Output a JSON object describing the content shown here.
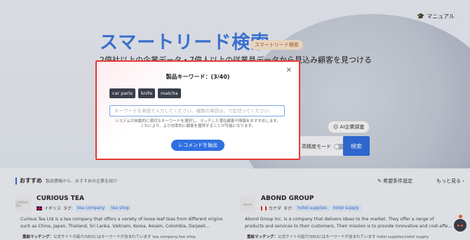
{
  "header": {
    "manual_label": "マニュアル"
  },
  "hero": {
    "title": "スマートリード検索",
    "badge": "スマートリード検索",
    "subtitle": "2億社以上の企業データ・7億人以上の従業員データから見込み顧客を見つける",
    "ai_button": "AI企業調査",
    "high_precision_label": "高精度モード",
    "search_button": "検索"
  },
  "modal": {
    "title": "製品キーワード：(3/40)",
    "keywords": [
      "car parts",
      "knife",
      "matcha"
    ],
    "input_placeholder": "キーワードを英語で入力してください。複数の単語は、で区切ってください。",
    "note_line1": "システムが自動的に適切なキーワードを選択し、マッチした潜在顧客や情報をおすすめします。",
    "note_line2": "これにより、より効率的に顧客を獲得することが可能になります。",
    "extract_button": "レコメンドを抽出"
  },
  "recommend": {
    "title": "おすすめ",
    "description": "製品情報から、おすすめの企業を紹介",
    "preference_link": "希望条件設定",
    "more_link": "もっと見る"
  },
  "companies": [
    {
      "name": "CURIOUS TEA",
      "logo_text": "CURIOUS TEA",
      "country": "イギリス",
      "tags_label": "タグ:",
      "tags": [
        "tea company",
        "tea shop"
      ],
      "description": "Curious Tea Ltd is a tea company that offers a variety of loose leaf teas from different origins such as China, Japan, Thailand, Sri Lanka, Vietnam, Korea, Assam, Colombia, Darjeeli...",
      "match_label": "重絵マッチング：",
      "match_text": "公式サイトの紹介/SEOにはキーワードが含まれています tea company,tea shop"
    },
    {
      "name": "ABOND GROUP",
      "logo_text": "abond",
      "country": "カナダ",
      "tags_label": "タグ:",
      "tags": [
        "hotel supplies",
        "hotel supply"
      ],
      "description": "Abond Group Inc. is a company that delivers ideas to the market. They offer a range of products and services to their customers. Their mission is to provide innovative and cost-effe...",
      "match_label": "重絵マッチング：",
      "match_text": "公式サイトの紹介/SEOにはキーワードが含まれています hotel supplies,hotel supply"
    }
  ],
  "colors": {
    "accent": "#2f6fe0",
    "modal_border": "#e53935",
    "chip_bg": "#3a3f4b"
  }
}
